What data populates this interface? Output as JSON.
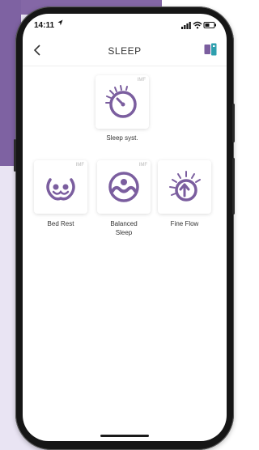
{
  "status_bar": {
    "time": "14:11"
  },
  "header": {
    "title": "SLEEP"
  },
  "accent_color": "#7b5e9f",
  "programs": [
    {
      "label": "Sleep syst.",
      "badge": "IMF",
      "icon": "sleep-dial-icon"
    },
    {
      "label": "Bed Rest",
      "badge": "IMF",
      "icon": "bed-rest-icon"
    },
    {
      "label": "Balanced Sleep",
      "badge": "IMF",
      "icon": "balanced-sleep-icon"
    },
    {
      "label": "Fine Flow",
      "badge": "",
      "icon": "fine-flow-icon"
    }
  ]
}
